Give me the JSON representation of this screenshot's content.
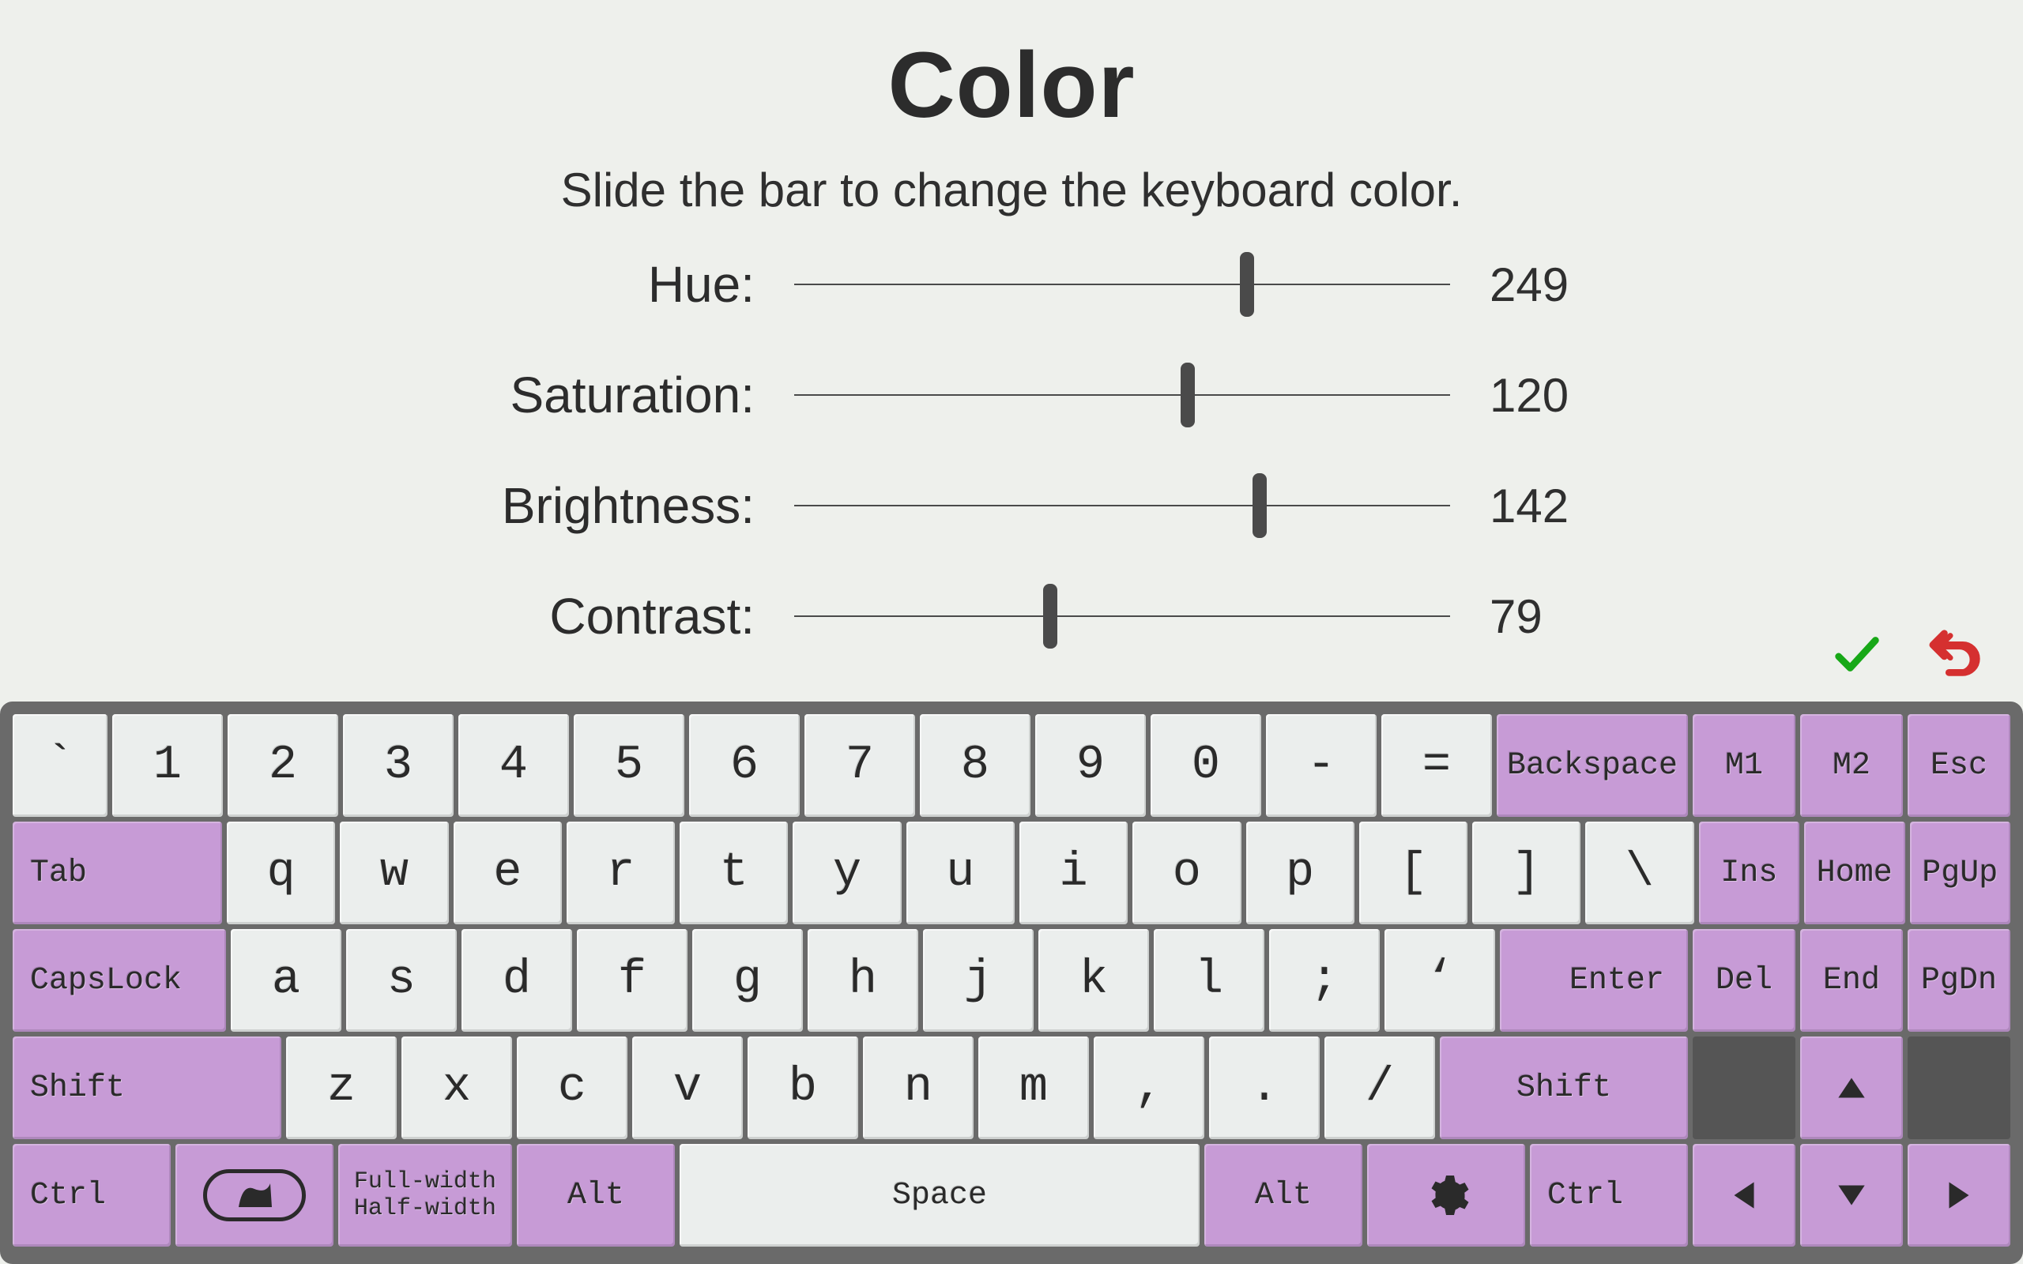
{
  "title": "Color",
  "subtitle": "Slide the bar to change the keyboard color.",
  "sliders": {
    "hue": {
      "label": "Hue:",
      "value": 249,
      "max": 360
    },
    "saturation": {
      "label": "Saturation:",
      "value": 120,
      "max": 200
    },
    "brightness": {
      "label": "Brightness:",
      "value": 142,
      "max": 200
    },
    "contrast": {
      "label": "Contrast:",
      "value": 79,
      "max": 200
    }
  },
  "keyboard": {
    "row1": [
      "`",
      "1",
      "2",
      "3",
      "4",
      "5",
      "6",
      "7",
      "8",
      "9",
      "0",
      "-",
      "="
    ],
    "row1_right": {
      "backspace": "Backspace",
      "m1": "M1",
      "m2": "M2",
      "esc": "Esc"
    },
    "row2_left": {
      "tab": "Tab"
    },
    "row2": [
      "q",
      "w",
      "e",
      "r",
      "t",
      "y",
      "u",
      "i",
      "o",
      "p",
      "[",
      "]",
      "\\"
    ],
    "row2_right": {
      "ins": "Ins",
      "home": "Home",
      "pgup": "PgUp"
    },
    "row3_left": {
      "caps": "CapsLock"
    },
    "row3": [
      "a",
      "s",
      "d",
      "f",
      "g",
      "h",
      "j",
      "k",
      "l",
      ";",
      "‘"
    ],
    "row3_right": {
      "enter": "Enter",
      "del": "Del",
      "end": "End",
      "pgdn": "PgDn"
    },
    "row4_left": {
      "shift": "Shift"
    },
    "row4": [
      "z",
      "x",
      "c",
      "v",
      "b",
      "n",
      "m",
      ",",
      ".",
      "/"
    ],
    "row4_right": {
      "shift2": "Shift"
    },
    "row5": {
      "ctrl": "Ctrl",
      "full": "Full-width",
      "half": "Half-width",
      "alt": "Alt",
      "space": "Space",
      "alt2": "Alt",
      "ctrl2": "Ctrl"
    }
  }
}
